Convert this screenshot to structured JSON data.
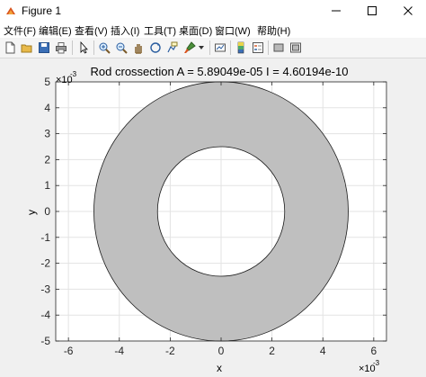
{
  "window": {
    "title": "Figure 1"
  },
  "menu": [
    {
      "label": "文件(F)"
    },
    {
      "label": "编辑(E)"
    },
    {
      "label": "查看(V)"
    },
    {
      "label": "插入(I)"
    },
    {
      "label": "工具(T)"
    },
    {
      "label": "桌面(D)"
    },
    {
      "label": "窗口(W)"
    },
    {
      "label": "帮助(H)"
    }
  ],
  "toolbar": {
    "icons": [
      "new-figure-icon",
      "open-file-icon",
      "save-icon",
      "print-icon",
      "pointer-icon",
      "zoom-in-icon",
      "zoom-out-icon",
      "pan-icon",
      "rotate-3d-icon",
      "data-cursor-icon",
      "brush-icon",
      "link-plot-icon",
      "colorbar-icon",
      "legend-icon",
      "hide-plot-tools-icon",
      "show-plot-tools-icon"
    ]
  },
  "colors": {
    "fill": "#bfbfbf",
    "edge": "#1a1a1a",
    "axes_bg": "#ffffff",
    "figure_bg": "#f0f0f0"
  },
  "chart_data": {
    "type": "area",
    "title": "Rod crossection A = 5.89049e-05  I = 4.60194e-10",
    "xlabel": "x",
    "ylabel": "y",
    "xlim": [
      -6.5,
      6.5
    ],
    "ylim": [
      -5,
      5
    ],
    "xticks": [
      -6,
      -4,
      -2,
      0,
      2,
      4,
      6
    ],
    "yticks": [
      -5,
      -4,
      -3,
      -2,
      -1,
      0,
      1,
      2,
      3,
      4,
      5
    ],
    "exponent_x": "×10",
    "exponent_y": "×10",
    "exponent_power": "-3",
    "grid": true,
    "series": [
      {
        "shape": "annulus",
        "center": [
          0,
          0
        ],
        "outer_radius": 5,
        "inner_radius": 2.5
      }
    ]
  }
}
